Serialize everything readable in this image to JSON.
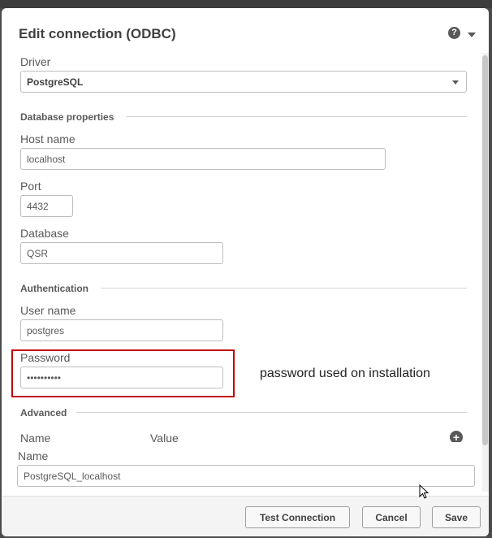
{
  "dialog": {
    "title": "Edit connection (ODBC)",
    "help_icon": "?"
  },
  "driver": {
    "label": "Driver",
    "value": "PostgreSQL"
  },
  "database_properties": {
    "heading": "Database properties",
    "host_name": {
      "label": "Host name",
      "value": "localhost"
    },
    "port": {
      "label": "Port",
      "value": "4432"
    },
    "database": {
      "label": "Database",
      "value": "QSR"
    }
  },
  "authentication": {
    "heading": "Authentication",
    "user_name": {
      "label": "User name",
      "value": "postgres"
    },
    "password": {
      "label": "Password",
      "value": "••••••••••"
    }
  },
  "annotation": "password used on installation",
  "advanced": {
    "heading": "Advanced",
    "col_name": "Name",
    "col_value": "Value",
    "add_icon": "plus-icon"
  },
  "name_field": {
    "label": "Name",
    "value": "PostgreSQL_localhost"
  },
  "footer": {
    "test_connection": "Test Connection",
    "cancel": "Cancel",
    "save": "Save"
  },
  "colors": {
    "highlight": "#c00000",
    "text": "#595959",
    "title": "#404040"
  }
}
